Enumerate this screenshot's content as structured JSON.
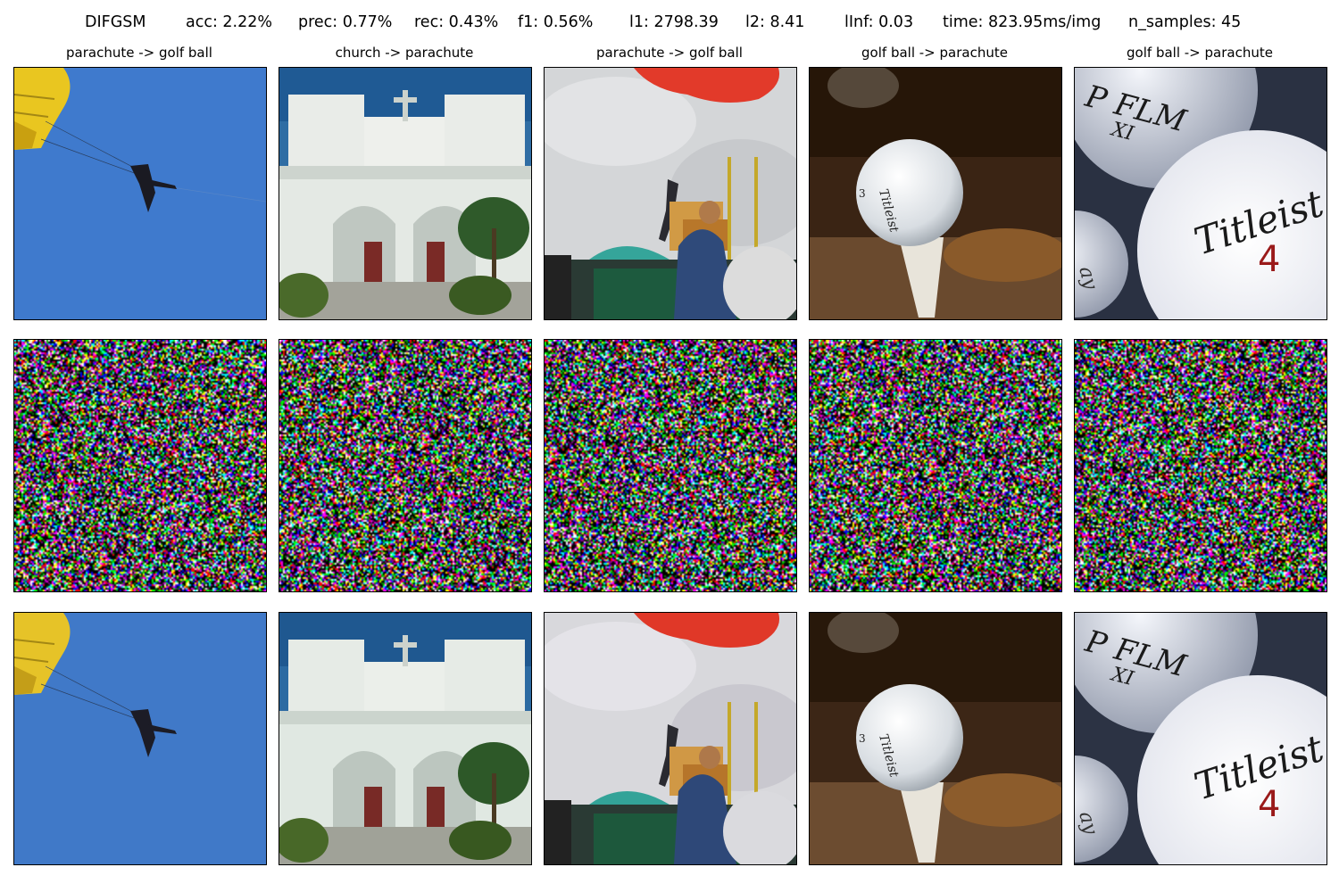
{
  "header": {
    "method": "DIFGSM",
    "acc": "acc: 2.22%",
    "prec": "prec: 0.77%",
    "rec": "rec: 0.43%",
    "f1": "f1: 0.56%",
    "l1": "l1: 2798.39",
    "l2": "l2: 8.41",
    "linf": "lInf: 0.03",
    "time": "time: 823.95ms/img",
    "n_samples": "n_samples: 45"
  },
  "columns": [
    {
      "title": "parachute -> golf ball"
    },
    {
      "title": "church -> parachute"
    },
    {
      "title": "parachute -> golf ball"
    },
    {
      "title": "golf ball -> parachute"
    },
    {
      "title": "golf ball -> parachute"
    }
  ],
  "ball_texts": {
    "brand_top": "P FLM",
    "brand_top2": "XI",
    "brand_main": "Titleist",
    "number": "4",
    "side": "Titleist",
    "side_num": "3",
    "left_ball": "ay"
  }
}
